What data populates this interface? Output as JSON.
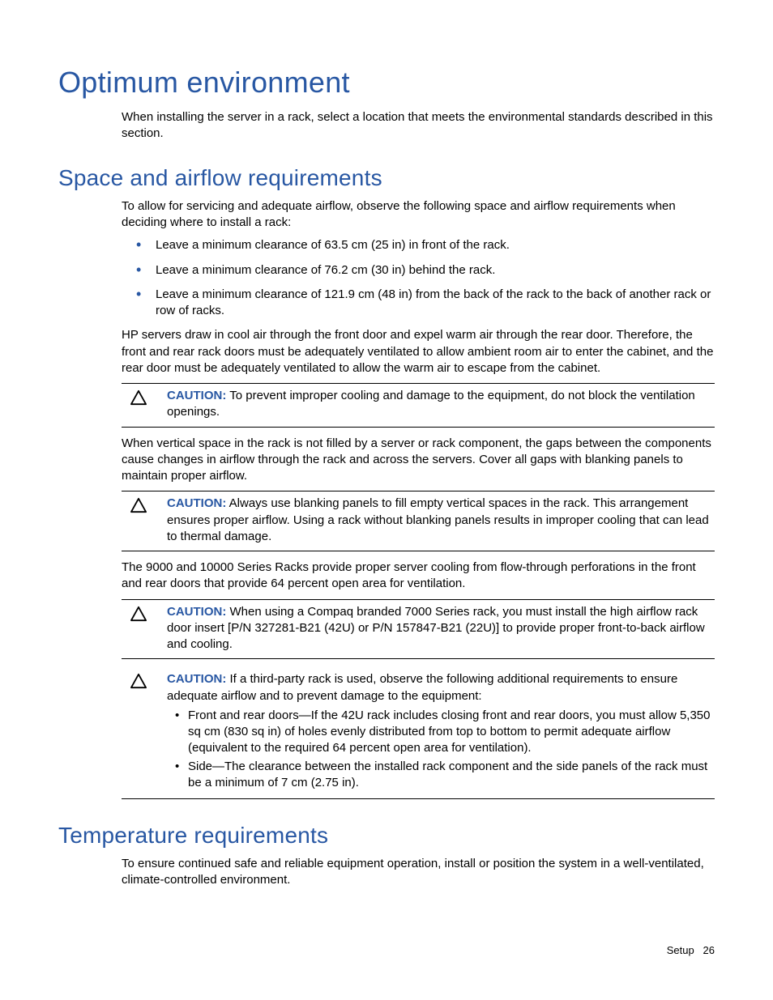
{
  "h1": "Optimum environment",
  "intro": "When installing the server in a rack, select a location that meets the environmental standards described in this section.",
  "space": {
    "title": "Space and airflow requirements",
    "lead": "To allow for servicing and adequate airflow, observe the following space and airflow requirements when deciding where to install a rack:",
    "bullets": [
      "Leave a minimum clearance of 63.5 cm (25 in) in front of the rack.",
      "Leave a minimum clearance of 76.2 cm (30 in) behind the rack.",
      "Leave a minimum clearance of 121.9 cm (48 in) from the back of the rack to the back of another rack or row of racks."
    ],
    "para2": "HP servers draw in cool air through the front door and expel warm air through the rear door. Therefore, the front and rear rack doors must be adequately ventilated to allow ambient room air to enter the cabinet, and the rear door must be adequately ventilated to allow the warm air to escape from the cabinet.",
    "caution1": {
      "label": "CAUTION:",
      "text": "To prevent improper cooling and damage to the equipment, do not block the ventilation openings."
    },
    "para3": "When vertical space in the rack is not filled by a server or rack component, the gaps between the components cause changes in airflow through the rack and across the servers. Cover all gaps with blanking panels to maintain proper airflow.",
    "caution2": {
      "label": "CAUTION:",
      "text": "Always use blanking panels to fill empty vertical spaces in the rack. This arrangement ensures proper airflow. Using a rack without blanking panels results in improper cooling that can lead to thermal damage."
    },
    "para4": "The 9000 and 10000 Series Racks provide proper server cooling from flow-through perforations in the front and rear doors that provide 64 percent open area for ventilation.",
    "caution3": {
      "label": "CAUTION:",
      "text": "When using a Compaq branded 7000 Series rack, you must install the high airflow rack door insert [P/N 327281-B21 (42U) or P/N 157847-B21 (22U)] to provide proper front-to-back airflow and cooling."
    },
    "caution4": {
      "label": "CAUTION:",
      "text": "If a third-party rack is used, observe the following additional requirements to ensure adequate airflow and to prevent damage to the equipment:",
      "items": [
        "Front and rear doors—If the 42U rack includes closing front and rear doors, you must allow 5,350 sq cm (830 sq in) of holes evenly distributed from top to bottom to permit adequate airflow (equivalent to the required 64 percent open area for ventilation).",
        "Side—The clearance between the installed rack component and the side panels of the rack must be a minimum of 7 cm (2.75 in)."
      ]
    }
  },
  "temp": {
    "title": "Temperature requirements",
    "para": "To ensure continued safe and reliable equipment operation, install or position the system in a well-ventilated, climate-controlled environment."
  },
  "footer": {
    "section": "Setup",
    "page": "26"
  }
}
